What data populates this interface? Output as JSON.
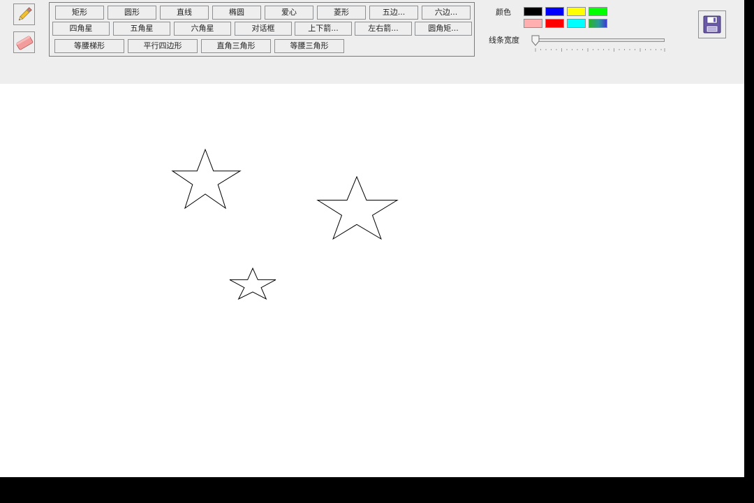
{
  "tools": {
    "pencil_icon": "pencil-icon",
    "eraser_icon": "eraser-icon"
  },
  "shape_buttons": {
    "row1": [
      "矩形",
      "圆形",
      "直线",
      "椭圆",
      "爱心",
      "菱形",
      "五边...",
      "六边..."
    ],
    "row2": [
      "四角星",
      "五角星",
      "六角星",
      "对话框",
      "上下箭...",
      "左右箭...",
      "圆角矩..."
    ],
    "row3": [
      "等腰梯形",
      "平行四边形",
      "直角三角形",
      "等腰三角形"
    ]
  },
  "colors": {
    "label": "颜色",
    "swatches": [
      "#000000",
      "#0000ff",
      "#ffff00",
      "#00ff00",
      "#ffafaf",
      "#ff0000",
      "#00ffff",
      "gradient"
    ]
  },
  "line_width": {
    "label": "线条宽度",
    "value": 0
  },
  "save": {
    "icon": "floppy-disk-icon"
  },
  "canvas": {
    "shapes": [
      {
        "type": "five-point-star"
      },
      {
        "type": "five-point-star"
      },
      {
        "type": "five-point-star"
      }
    ]
  }
}
